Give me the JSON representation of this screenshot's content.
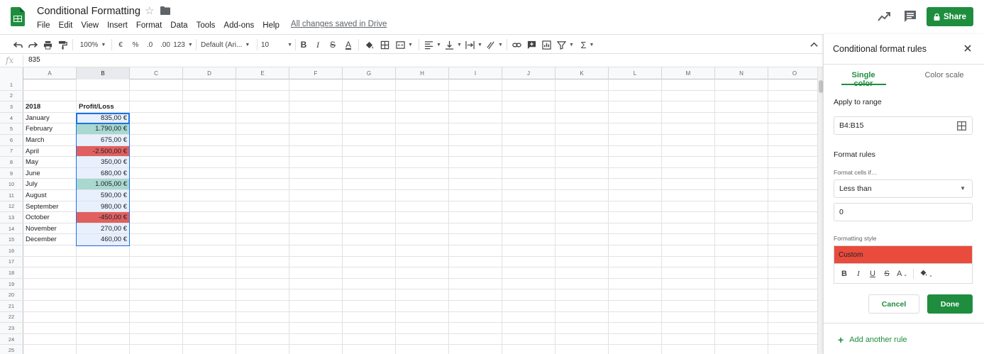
{
  "app": {
    "doc_title": "Conditional Formatting",
    "saved_status": "All changes saved in Drive",
    "share_label": "Share",
    "brand_color": "#1e8e3e"
  },
  "menu": [
    "File",
    "Edit",
    "View",
    "Insert",
    "Format",
    "Data",
    "Tools",
    "Add-ons",
    "Help"
  ],
  "toolbar": {
    "zoom": "100%",
    "currency": "€",
    "percent": "%",
    "dec_decrease": ".0",
    "dec_increase": ".00",
    "more_formats": "123",
    "font": "Default (Ari...",
    "font_size": "10",
    "bold": "B",
    "italic": "I",
    "strike": "S",
    "text_color": "A",
    "sum": "Σ"
  },
  "formula_bar": {
    "fx": "fx",
    "value": "835"
  },
  "grid": {
    "columns": [
      "A",
      "B",
      "C",
      "D",
      "E",
      "F",
      "G",
      "H",
      "I",
      "J",
      "K",
      "L",
      "M",
      "N",
      "O"
    ],
    "selected_column": "B",
    "rows": [
      {
        "n": "1",
        "a": "",
        "b": "",
        "fill": ""
      },
      {
        "n": "2",
        "a": "",
        "b": "",
        "fill": ""
      },
      {
        "n": "3",
        "a": "2018",
        "b": "Profit/Loss",
        "fill": "header"
      },
      {
        "n": "4",
        "a": "January",
        "b": "835,00 €",
        "fill": "sel"
      },
      {
        "n": "5",
        "a": "February",
        "b": "1.790,00 €",
        "fill": "green"
      },
      {
        "n": "6",
        "a": "March",
        "b": "675,00 €",
        "fill": "sel"
      },
      {
        "n": "7",
        "a": "April",
        "b": "-2.500,00 €",
        "fill": "red"
      },
      {
        "n": "8",
        "a": "May",
        "b": "350,00 €",
        "fill": "sel"
      },
      {
        "n": "9",
        "a": "June",
        "b": "680,00 €",
        "fill": "sel"
      },
      {
        "n": "10",
        "a": "July",
        "b": "1.005,00 €",
        "fill": "green"
      },
      {
        "n": "11",
        "a": "August",
        "b": "590,00 €",
        "fill": "sel"
      },
      {
        "n": "12",
        "a": "September",
        "b": "980,00 €",
        "fill": "sel"
      },
      {
        "n": "13",
        "a": "October",
        "b": "-450,00 €",
        "fill": "red"
      },
      {
        "n": "14",
        "a": "November",
        "b": "270,00 €",
        "fill": "sel"
      },
      {
        "n": "15",
        "a": "December",
        "b": "460,00 €",
        "fill": "sel"
      },
      {
        "n": "16",
        "a": "",
        "b": "",
        "fill": ""
      },
      {
        "n": "17",
        "a": "",
        "b": "",
        "fill": ""
      },
      {
        "n": "18",
        "a": "",
        "b": "",
        "fill": ""
      },
      {
        "n": "19",
        "a": "",
        "b": "",
        "fill": ""
      },
      {
        "n": "20",
        "a": "",
        "b": "",
        "fill": ""
      },
      {
        "n": "21",
        "a": "",
        "b": "",
        "fill": ""
      },
      {
        "n": "22",
        "a": "",
        "b": "",
        "fill": ""
      },
      {
        "n": "23",
        "a": "",
        "b": "",
        "fill": ""
      },
      {
        "n": "24",
        "a": "",
        "b": "",
        "fill": ""
      },
      {
        "n": "25",
        "a": "",
        "b": "",
        "fill": ""
      }
    ],
    "colors": {
      "sel": "#e8f0fe",
      "green": "#a8d8d0",
      "red": "#e06060"
    }
  },
  "panel": {
    "title": "Conditional format rules",
    "tab_single": "Single color",
    "tab_scale": "Color scale",
    "apply_label": "Apply to range",
    "range_value": "B4:B15",
    "format_rules_label": "Format rules",
    "cells_if_label": "Format cells if…",
    "condition": "Less than",
    "value": "0",
    "style_label": "Formatting style",
    "style_preview": "Custom",
    "style_color": "#e94b3c",
    "cancel_label": "Cancel",
    "done_label": "Done",
    "add_rule_label": "Add another rule"
  }
}
